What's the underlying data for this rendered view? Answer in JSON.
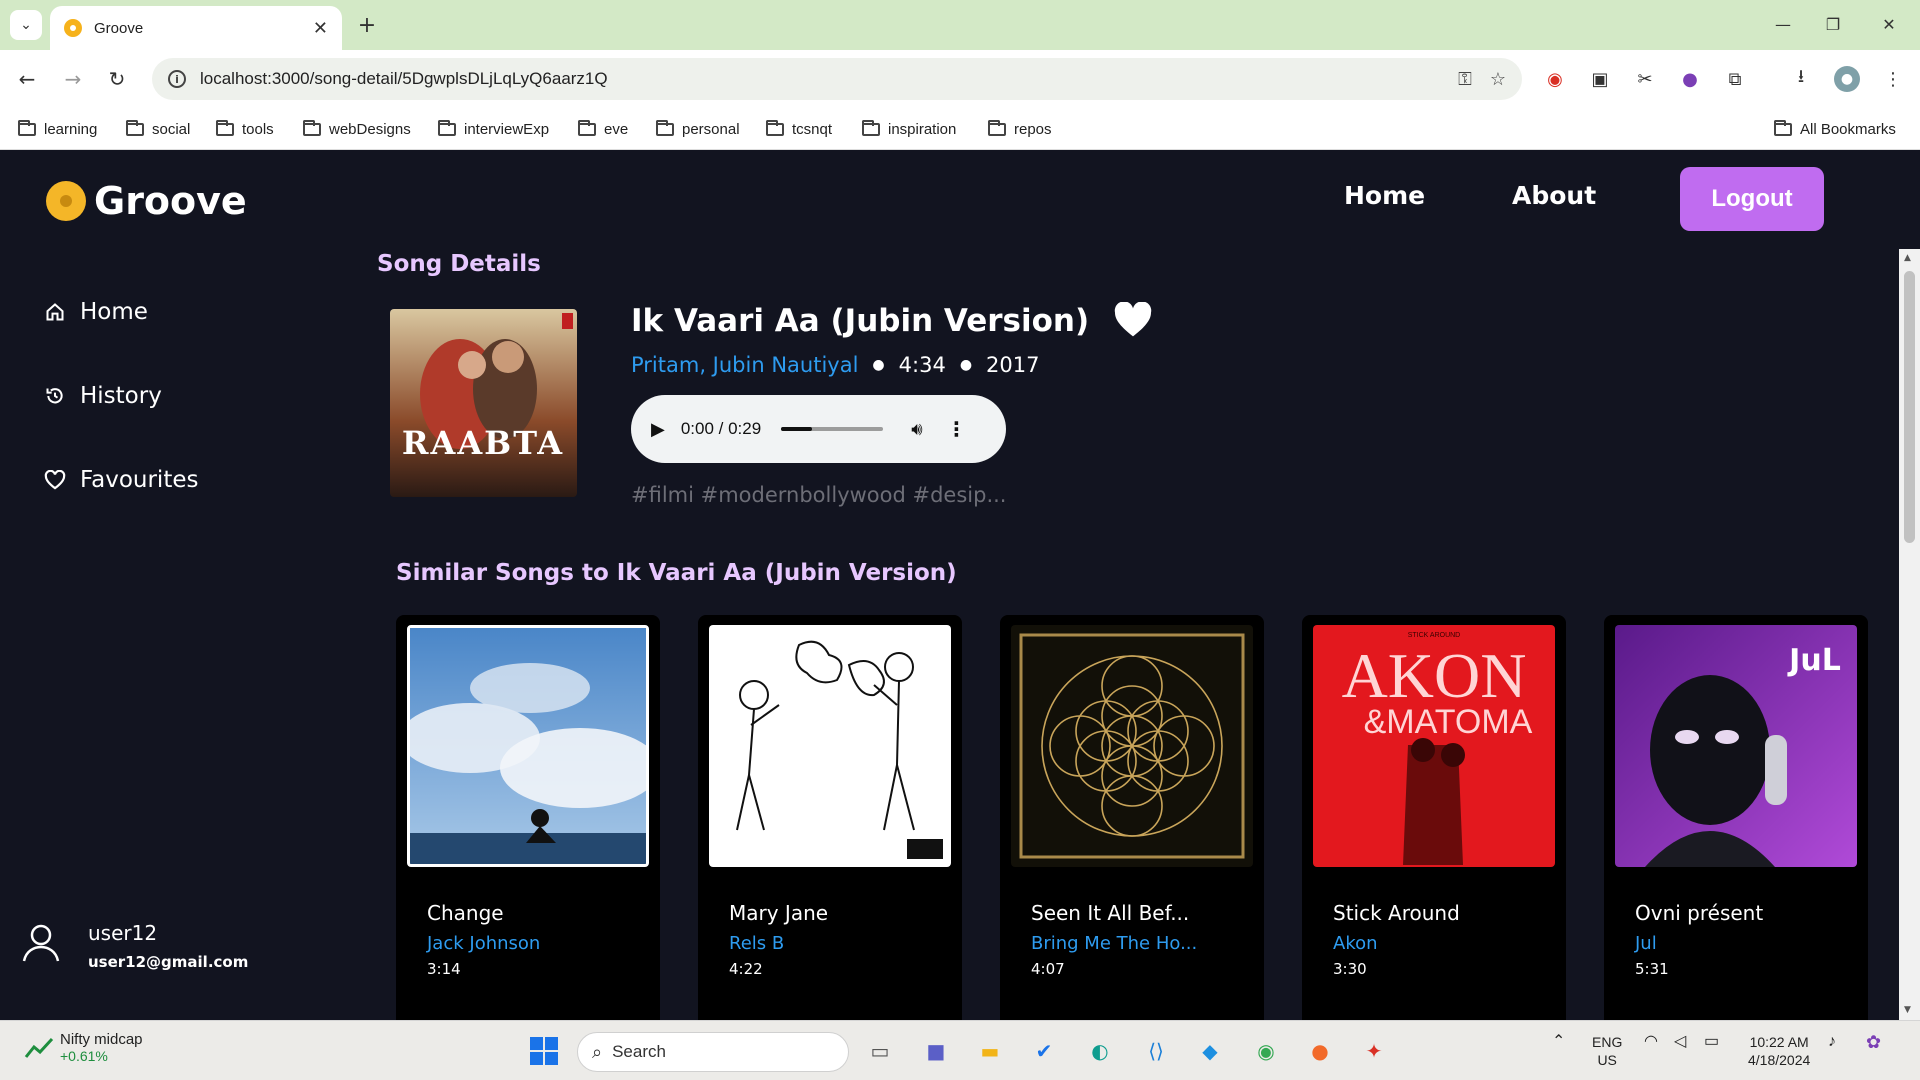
{
  "browser": {
    "tab_title": "Groove",
    "url": "localhost:3000/song-detail/5DgwplsDLjLqLyQ6aarz1Q",
    "bookmarks": [
      "learning",
      "social",
      "tools",
      "webDesigns",
      "interviewExp",
      "eve",
      "personal",
      "tcsnqt",
      "inspiration",
      "repos"
    ],
    "all_bookmarks": "All Bookmarks"
  },
  "app": {
    "brand": "Groove",
    "nav": {
      "home": "Home",
      "about": "About",
      "logout": "Logout"
    },
    "sidebar": [
      {
        "label": "Home",
        "icon": "home-icon"
      },
      {
        "label": "History",
        "icon": "history-icon"
      },
      {
        "label": "Favourites",
        "icon": "heart-outline-icon"
      }
    ],
    "user": {
      "name": "user12",
      "email": "user12@gmail.com"
    },
    "accent_color": "#c06cf0",
    "link_color": "#2e9cf0"
  },
  "song": {
    "section_title": "Song Details",
    "title": "Ik Vaari Aa (Jubin Version)",
    "artists": "Pritam, Jubin Nautiyal",
    "duration": "4:34",
    "year": "2017",
    "album_art_text": "RAABTA",
    "player": {
      "time": "0:00 / 0:29",
      "progress_fraction": 0.3
    },
    "tags": "#filmi #modernbollywood #desip..."
  },
  "similar": {
    "title": "Similar Songs to Ik Vaari Aa (Jubin Version)",
    "songs": [
      {
        "title": "Change",
        "artist": "Jack Johnson",
        "duration": "3:14"
      },
      {
        "title": "Mary Jane",
        "artist": "Rels B",
        "duration": "4:22"
      },
      {
        "title": "Seen It All Bef...",
        "artist": "Bring Me The Ho...",
        "duration": "4:07"
      },
      {
        "title": "Stick Around",
        "artist": "Akon",
        "duration": "3:30",
        "art_text": "AKON",
        "art_subtext": "&MATOMA",
        "art_top": "STICK AROUND"
      },
      {
        "title": "Ovni présent",
        "artist": "Jul",
        "duration": "5:31",
        "art_text": "JuL"
      }
    ]
  },
  "taskbar": {
    "widget_name": "Nifty midcap",
    "widget_change": "+0.61%",
    "search_label": "Search",
    "lang_top": "ENG",
    "lang_bottom": "US",
    "time": "10:22 AM",
    "date": "4/18/2024"
  }
}
